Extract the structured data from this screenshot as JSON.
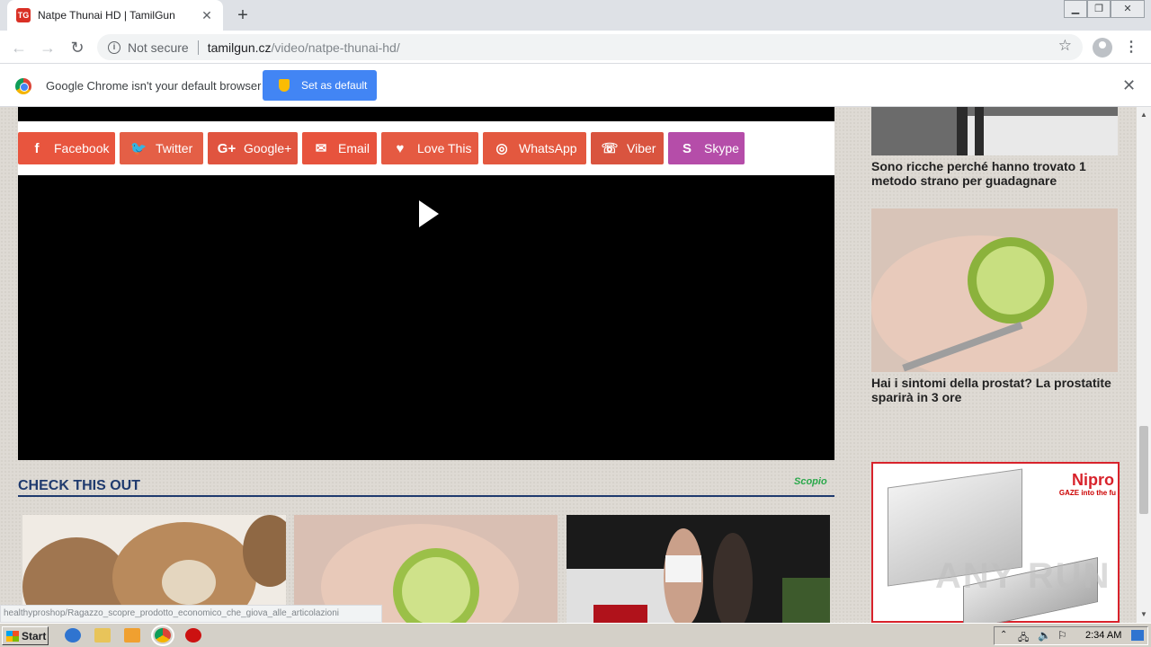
{
  "browser": {
    "tab_title": "Natpe Thunai HD | TamilGun",
    "not_secure": "Not secure",
    "url_host": "tamilgun.cz",
    "url_path": "/video/natpe-thunai-hd/"
  },
  "infobar": {
    "message": "Google Chrome isn't your default browser",
    "button_label": "Set as default"
  },
  "share_buttons": [
    {
      "label": "Facebook",
      "icon": "f",
      "color": "#e8553e"
    },
    {
      "label": "Twitter",
      "icon": "t",
      "color": "#e45f46"
    },
    {
      "label": "Google+",
      "icon": "G+",
      "color": "#e0543f"
    },
    {
      "label": "Email",
      "icon": "✉",
      "color": "#e7533d"
    },
    {
      "label": "Love This",
      "icon": "♥",
      "color": "#e55a42"
    },
    {
      "label": "WhatsApp",
      "icon": "◎",
      "color": "#e3583f"
    },
    {
      "label": "Viber",
      "icon": "☏",
      "color": "#d9543f"
    },
    {
      "label": "Skype",
      "icon": "S",
      "color": "#b54da9"
    }
  ],
  "section": {
    "title": "CHECK THIS OUT",
    "sponsor": "Scopio"
  },
  "sidebar": {
    "captions": [
      "Sono ricche perché hanno trovato 1 metodo strano per guadagnare",
      "Hai i sintomi della prostat? La prostatite sparirà in 3 ore"
    ],
    "ad_brand": "Nipro",
    "ad_sub": "GAZE into the fu"
  },
  "watermark": "ANY RUN",
  "status_url": "healthyproshop/Ragazzo_scopre_prodotto_economico_che_giova_alle_articolazioni",
  "taskbar": {
    "start": "Start",
    "clock": "2:34 AM"
  }
}
